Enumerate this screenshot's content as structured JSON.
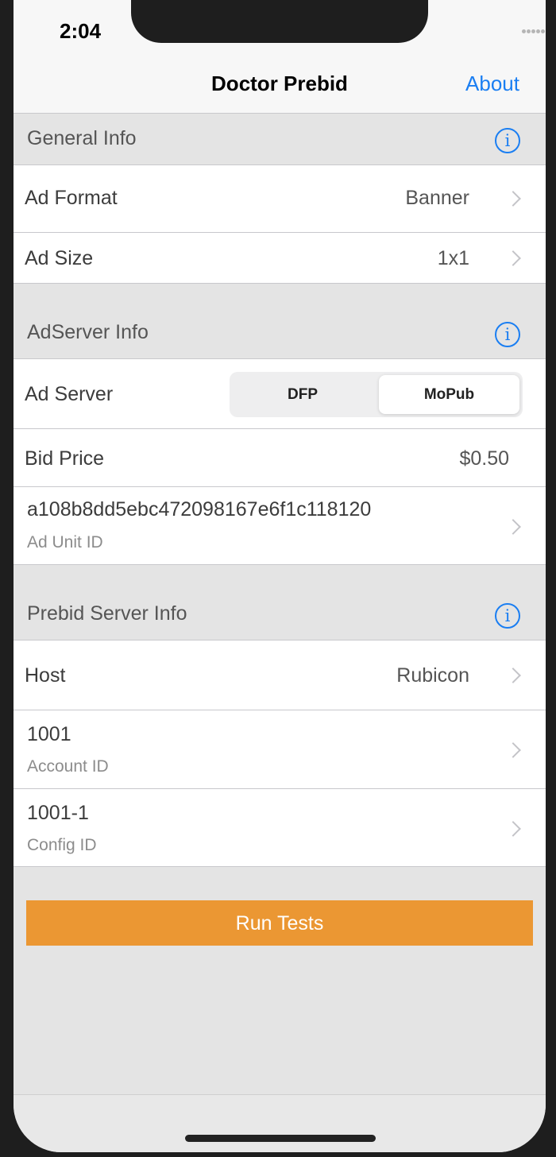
{
  "status_bar": {
    "time": "2:04"
  },
  "nav": {
    "title": "Doctor Prebid",
    "about": "About"
  },
  "general": {
    "header": "General Info",
    "ad_format": {
      "label": "Ad Format",
      "value": "Banner"
    },
    "ad_size": {
      "label": "Ad Size",
      "value": "1x1"
    }
  },
  "adserver": {
    "header": "AdServer Info",
    "ad_server": {
      "label": "Ad Server",
      "options": [
        "DFP",
        "MoPub"
      ],
      "selected": "MoPub"
    },
    "bid_price": {
      "label": "Bid Price",
      "value": "$0.50"
    },
    "ad_unit": {
      "value": "a108b8dd5ebc472098167e6f1c118120",
      "label": "Ad Unit ID"
    }
  },
  "prebid": {
    "header": "Prebid Server Info",
    "host": {
      "label": "Host",
      "value": "Rubicon"
    },
    "account": {
      "value": "1001",
      "label": "Account ID"
    },
    "config": {
      "value": "1001-1",
      "label": "Config ID"
    }
  },
  "actions": {
    "run_tests": "Run Tests"
  },
  "colors": {
    "accent": "#1a7ef2",
    "run_button": "#eb9733"
  }
}
